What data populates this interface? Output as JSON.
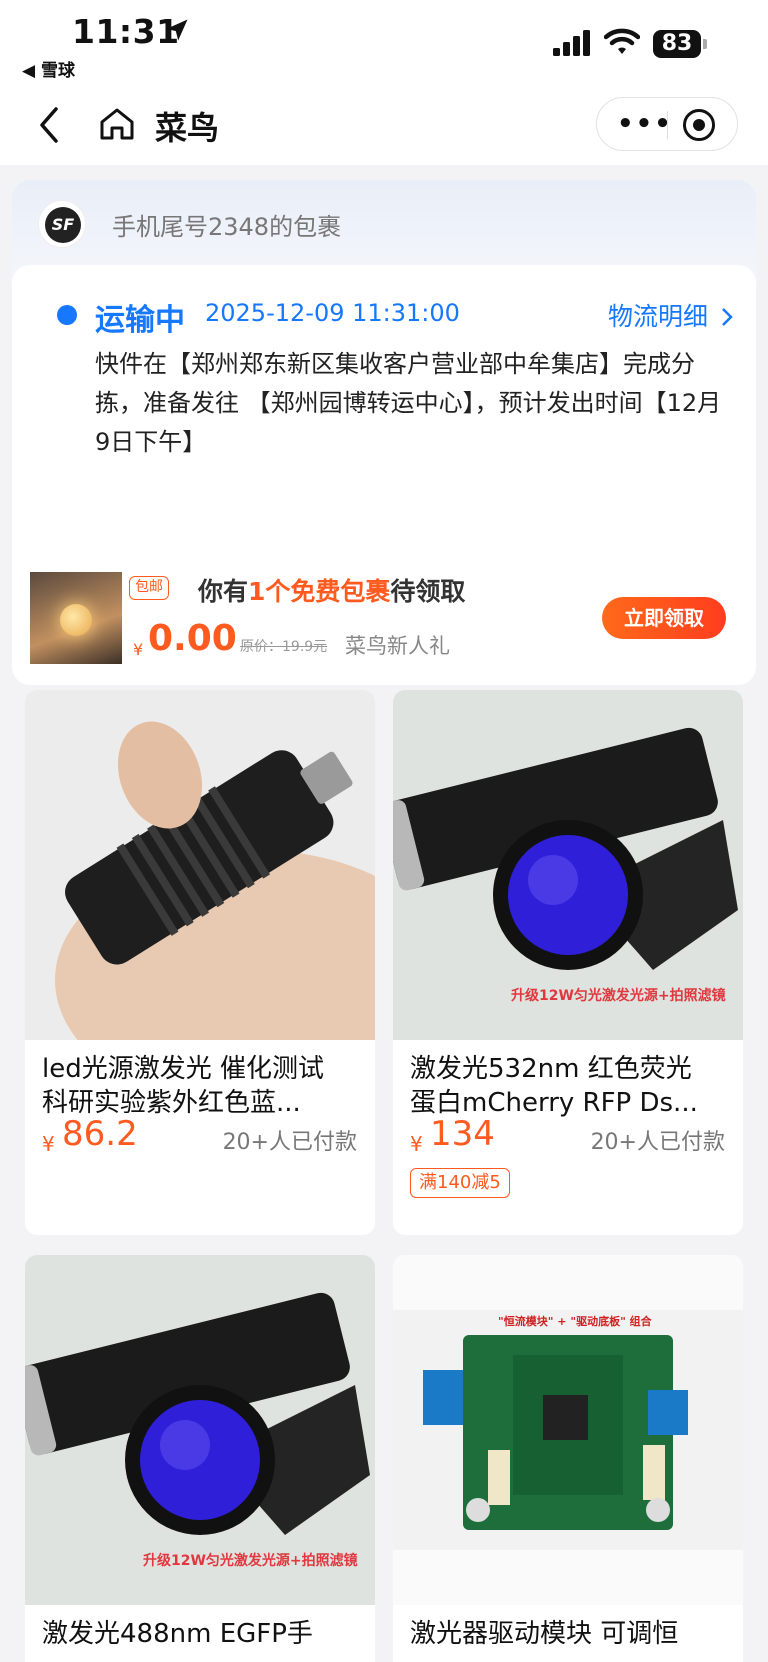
{
  "status_bar": {
    "time": "11:31",
    "back_app": "◀ 雪球",
    "battery": "83"
  },
  "navbar": {
    "title": "菜鸟"
  },
  "package": {
    "carrier_logo": "SF",
    "title": "手机尾号2348的包裹",
    "status": "运输中",
    "timestamp": "2025-12-09 11:31:00",
    "detail_link": "物流明细",
    "description": "快件在【郑州郑东新区集收客户营业部中牟集店】完成分拣，准备发往 【郑州园博转运中心】，预计发出时间【12月9日下午】"
  },
  "promo": {
    "badge": "包邮",
    "line_prefix": "你有",
    "line_highlight": "1个免费包裹",
    "line_suffix": "待领取",
    "currency": "¥",
    "price": "0.00",
    "original_price": "原价：19.9元",
    "subtitle": "菜鸟新人礼",
    "button": "立即领取"
  },
  "products": [
    {
      "title_line1": "led光源激发光 催化测试",
      "title_line2": "科研实验紫外红色蓝...",
      "currency": "¥",
      "price": "86.2",
      "sales": "20+人已付款",
      "coupon": ""
    },
    {
      "title_line1": "激发光532nm 红色荧光",
      "title_line2": "蛋白mCherry RFP Ds...",
      "currency": "¥",
      "price": "134",
      "sales": "20+人已付款",
      "coupon": "满140减5",
      "image_caption": "升级12W匀光激发光源+拍照滤镜"
    },
    {
      "title_line1": "激发光488nm EGFP手",
      "title_line2": "",
      "currency": "",
      "price": "",
      "sales": "",
      "coupon": "",
      "image_caption": "升级12W匀光激发光源+拍照滤镜"
    },
    {
      "title_line1": "激光器驱动模块 可调恒",
      "title_line2": "",
      "currency": "",
      "price": "",
      "sales": "",
      "coupon": "",
      "image_caption": "\"恒流模块\" + \"驱动底板\" 组合"
    }
  ]
}
